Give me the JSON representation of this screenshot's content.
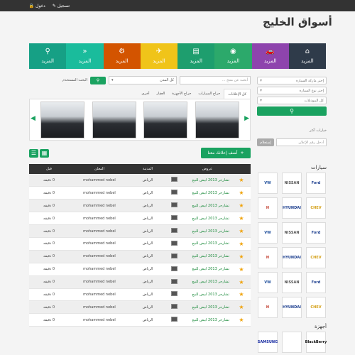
{
  "topbar": {
    "login": "دخول",
    "register": "تسجيل"
  },
  "site": {
    "logo": "أسواق الخليج"
  },
  "tiles": [
    {
      "label": "المزيد",
      "icon": "⌂",
      "color": "#2f3b4a"
    },
    {
      "label": "المزيد",
      "icon": "🚗",
      "color": "#8e44ad"
    },
    {
      "label": "المزيد",
      "icon": "◉",
      "color": "#2ca96b"
    },
    {
      "label": "المزيد",
      "icon": "▤",
      "color": "#1e9e6e"
    },
    {
      "label": "المزيد",
      "icon": "✈",
      "color": "#f0c419"
    },
    {
      "label": "المزيد",
      "icon": "⚙",
      "color": "#d35400"
    },
    {
      "label": "المزيد",
      "icon": "»",
      "color": "#1abc9c"
    },
    {
      "label": "المزيد",
      "icon": "⚲",
      "color": "#16a085"
    }
  ],
  "sidebar": {
    "select1": "إختر ماركة السيارة",
    "select2": "إختر نوع السيارة",
    "select3": "كل الموديلات",
    "more_options": "خيارات أكثر",
    "ad_number_placeholder": "أدخل رقم الإعلان",
    "ad_number_button": "إستعلام",
    "cars_title": "سيارات",
    "devices_title": "أجهزة",
    "brands": [
      {
        "name": "VW",
        "color": "#1d4d9b"
      },
      {
        "name": "NISSAN",
        "color": "#555"
      },
      {
        "name": "Ford",
        "color": "#1d3f8f"
      },
      {
        "name": "H",
        "color": "#c0392b"
      },
      {
        "name": "HYUNDAI",
        "color": "#1d3f8f"
      },
      {
        "name": "CHEV",
        "color": "#d4a017"
      },
      {
        "name": "VW",
        "color": "#1d4d9b"
      },
      {
        "name": "NISSAN",
        "color": "#555"
      },
      {
        "name": "Ford",
        "color": "#1d3f8f"
      },
      {
        "name": "H",
        "color": "#c0392b"
      },
      {
        "name": "HYUNDAI",
        "color": "#1d3f8f"
      },
      {
        "name": "CHEV",
        "color": "#d4a017"
      },
      {
        "name": "VW",
        "color": "#1d4d9b"
      },
      {
        "name": "NISSAN",
        "color": "#555"
      },
      {
        "name": "Ford",
        "color": "#1d3f8f"
      },
      {
        "name": "H",
        "color": "#c0392b"
      },
      {
        "name": "HYUNDAI",
        "color": "#1d3f8f"
      },
      {
        "name": "CHEV",
        "color": "#d4a017"
      }
    ],
    "devices": [
      {
        "name": "SAMSUNG",
        "color": "#1428a0"
      },
      {
        "name": "",
        "color": "#111"
      },
      {
        "name": "BlackBerry",
        "color": "#111"
      }
    ]
  },
  "search": {
    "keyword_placeholder": "أبحث عن منتج ...",
    "city": "كل المدن",
    "advanced": "البحث المستخدم"
  },
  "tabs": [
    "كل الإعلانات",
    "حراج السيارات",
    "حراج الأجهزة",
    "العقار",
    "أخرى"
  ],
  "actions": {
    "add_ad": "أضف إعلانك معنا"
  },
  "table": {
    "headers": [
      "عروض",
      "",
      "المدينة",
      "المعلن",
      "قبل"
    ],
    "rows": [
      {
        "title": "تشارجر 2013 ابيض للبيع",
        "city": "الرياض",
        "advertiser": "mohammed nebel",
        "ago": "0 دقيقه"
      },
      {
        "title": "تشارجر 2013 ابيض للبيع",
        "city": "الرياض",
        "advertiser": "mohammed nebel",
        "ago": "0 دقيقه"
      },
      {
        "title": "تشارجر 2013 ابيض للبيع",
        "city": "الرياض",
        "advertiser": "mohammed nebel",
        "ago": "0 دقيقه"
      },
      {
        "title": "تشارجر 2013 ابيض للبيع",
        "city": "الرياض",
        "advertiser": "mohammed nebel",
        "ago": "0 دقيقه"
      },
      {
        "title": "تشارجر 2013 ابيض للبيع",
        "city": "الرياض",
        "advertiser": "mohammed nebel",
        "ago": "0 دقيقه"
      },
      {
        "title": "تشارجر 2013 ابيض للبيع",
        "city": "الرياض",
        "advertiser": "mohammed nebel",
        "ago": "0 دقيقه"
      },
      {
        "title": "تشارجر 2013 ابيض للبيع",
        "city": "الرياض",
        "advertiser": "mohammed nebel",
        "ago": "0 دقيقه"
      },
      {
        "title": "تشارجر 2013 ابيض للبيع",
        "city": "الرياض",
        "advertiser": "mohammed nebel",
        "ago": "0 دقيقه"
      },
      {
        "title": "تشارجر 2013 ابيض للبيع",
        "city": "الرياض",
        "advertiser": "mohammed nebel",
        "ago": "0 دقيقه"
      },
      {
        "title": "تشارجر 2013 ابيض للبيع",
        "city": "الرياض",
        "advertiser": "mohammed nebel",
        "ago": "0 دقيقه"
      },
      {
        "title": "تشارجر 2013 ابيض للبيع",
        "city": "الرياض",
        "advertiser": "mohammed nebel",
        "ago": "0 دقيقه"
      },
      {
        "title": "تشارجر 2013 ابيض للبيع",
        "city": "الرياض",
        "advertiser": "mohammed nebel",
        "ago": "0 دقيقه"
      }
    ]
  }
}
